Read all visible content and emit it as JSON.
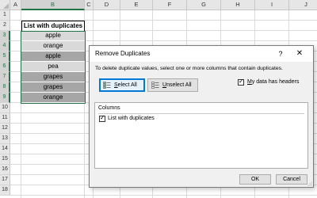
{
  "sheet": {
    "columns": [
      "A",
      "B",
      "C",
      "D",
      "E",
      "F",
      "G",
      "H",
      "I",
      "J"
    ],
    "rows": [
      "1",
      "2",
      "3",
      "4",
      "5",
      "6",
      "7",
      "8",
      "9",
      "10",
      "11",
      "12",
      "13",
      "14",
      "15",
      "16",
      "17",
      "18"
    ],
    "header_cell": "List with duplicates",
    "items": [
      {
        "text": "apple",
        "shade": "light"
      },
      {
        "text": "orange",
        "shade": "light"
      },
      {
        "text": "apple",
        "shade": "dark"
      },
      {
        "text": "pea",
        "shade": "light"
      },
      {
        "text": "grapes",
        "shade": "dark"
      },
      {
        "text": "grapes",
        "shade": "dark"
      },
      {
        "text": "orange",
        "shade": "dark"
      }
    ]
  },
  "dialog": {
    "title": "Remove Duplicates",
    "help_icon": "?",
    "close_icon": "✕",
    "instruction": "To delete duplicate values, select one or more columns that contain duplicates.",
    "select_all_pre": "",
    "select_all_u": "S",
    "select_all_post": "elect All",
    "unselect_all_pre": "",
    "unselect_all_u": "U",
    "unselect_all_post": "nselect All",
    "headers_pre": "",
    "headers_u": "M",
    "headers_post": "y data has headers",
    "headers_checked": true,
    "columns_title": "Columns",
    "column_items": [
      {
        "label": "List with duplicates",
        "checked": true
      }
    ],
    "ok_label": "OK",
    "cancel_label": "Cancel"
  },
  "colors": {
    "excel_green": "#217346",
    "dark_shade": "#a6a6a6",
    "light_shade": "#d9d9d9",
    "focus_blue": "#0078d7"
  }
}
